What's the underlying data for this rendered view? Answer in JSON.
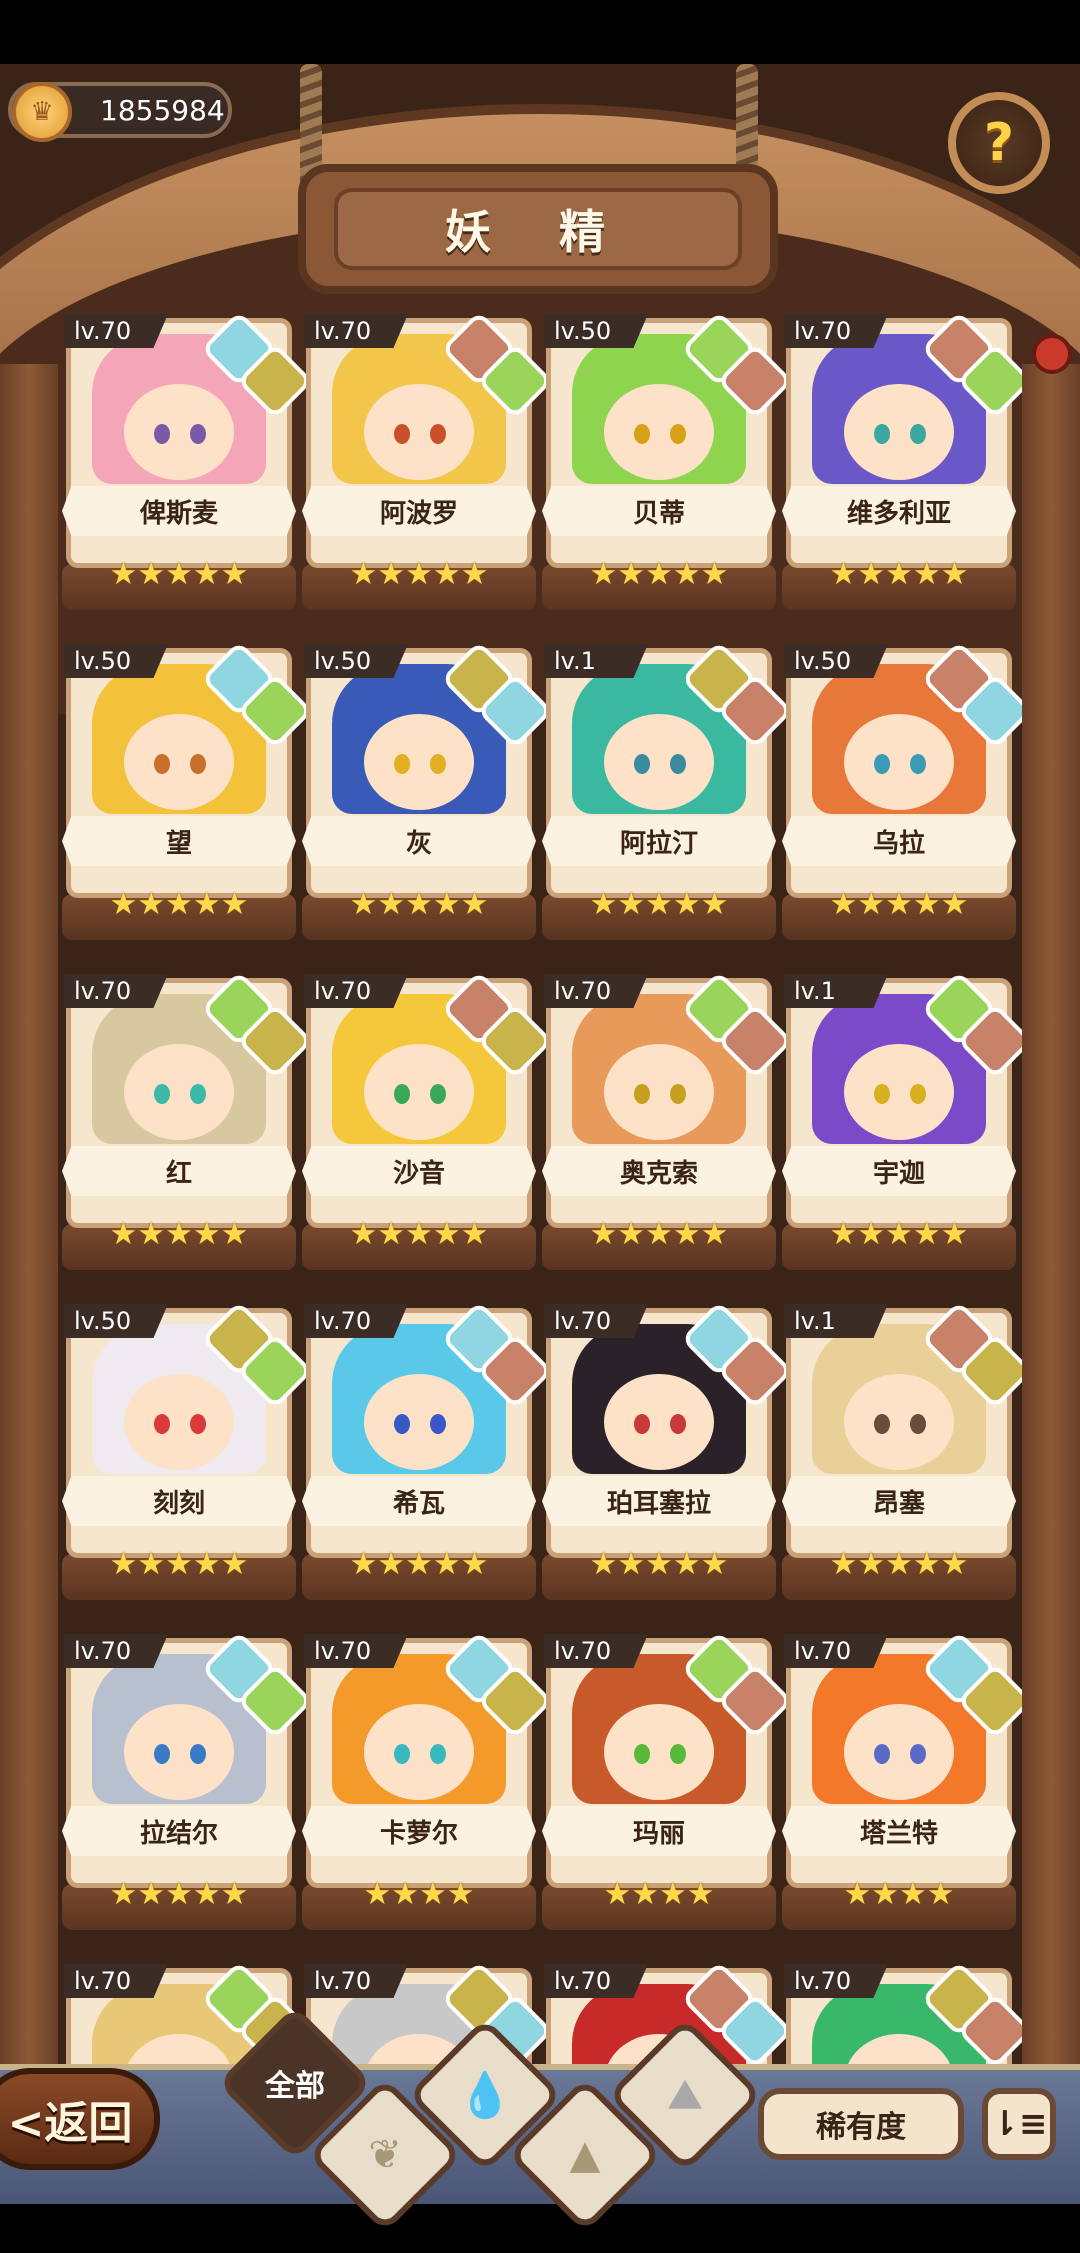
{
  "header": {
    "coins": "1855984",
    "title": "妖 精",
    "help_label": "?"
  },
  "fairies": [
    {
      "level": "lv.70",
      "name": "俾斯麦",
      "stars": "★★★★★",
      "elements": [
        "water",
        "earth"
      ],
      "hair": "#f4a6b8",
      "eye": "#7a5aa8"
    },
    {
      "level": "lv.70",
      "name": "阿波罗",
      "stars": "★★★★★",
      "elements": [
        "fire",
        "wood"
      ],
      "hair": "#f2c64a",
      "eye": "#c8502a"
    },
    {
      "level": "lv.50",
      "name": "贝蒂",
      "stars": "★★★★★",
      "elements": [
        "wood",
        "fire"
      ],
      "hair": "#8fd44e",
      "eye": "#d8a018"
    },
    {
      "level": "lv.70",
      "name": "维多利亚",
      "stars": "★★★★★",
      "elements": [
        "fire",
        "wood"
      ],
      "hair": "#6a58c8",
      "eye": "#3aa8a0"
    },
    {
      "level": "lv.50",
      "name": "望",
      "stars": "★★★★★",
      "elements": [
        "water",
        "wood"
      ],
      "hair": "#f4c23a",
      "eye": "#c8702a"
    },
    {
      "level": "lv.50",
      "name": "灰",
      "stars": "★★★★★",
      "elements": [
        "earth",
        "water"
      ],
      "hair": "#3a5ab8",
      "eye": "#e0b020"
    },
    {
      "level": "lv.1",
      "name": "阿拉汀",
      "stars": "★★★★★",
      "elements": [
        "earth",
        "fire"
      ],
      "hair": "#3ab8a0",
      "eye": "#3a8aa0"
    },
    {
      "level": "lv.50",
      "name": "乌拉",
      "stars": "★★★★★",
      "elements": [
        "fire",
        "water"
      ],
      "hair": "#e8783a",
      "eye": "#3a9ab8"
    },
    {
      "level": "lv.70",
      "name": "红",
      "stars": "★★★★★",
      "elements": [
        "wood",
        "earth"
      ],
      "hair": "#d8c8a0",
      "eye": "#3ab8a8"
    },
    {
      "level": "lv.70",
      "name": "沙音",
      "stars": "★★★★★",
      "elements": [
        "fire",
        "earth"
      ],
      "hair": "#f4c83a",
      "eye": "#3aa858"
    },
    {
      "level": "lv.70",
      "name": "奥克索",
      "stars": "★★★★★",
      "elements": [
        "wood",
        "fire"
      ],
      "hair": "#e89a5a",
      "eye": "#c8a020"
    },
    {
      "level": "lv.1",
      "name": "宇迦",
      "stars": "★★★★★",
      "elements": [
        "wood",
        "fire"
      ],
      "hair": "#7a4ac8",
      "eye": "#d8b020"
    },
    {
      "level": "lv.50",
      "name": "刻刻",
      "stars": "★★★★★",
      "elements": [
        "earth",
        "wood"
      ],
      "hair": "#eeeaf0",
      "eye": "#d83a3a"
    },
    {
      "level": "lv.70",
      "name": "希瓦",
      "stars": "★★★★★",
      "elements": [
        "water",
        "fire"
      ],
      "hair": "#5ac8e8",
      "eye": "#3a58c8"
    },
    {
      "level": "lv.70",
      "name": "珀耳塞拉",
      "stars": "★★★★★",
      "elements": [
        "water",
        "fire"
      ],
      "hair": "#2a2228",
      "eye": "#c83a3a"
    },
    {
      "level": "lv.1",
      "name": "昂塞",
      "stars": "★★★★★",
      "elements": [
        "fire",
        "earth"
      ],
      "hair": "#e8d098",
      "eye": "#6a4a3a"
    },
    {
      "level": "lv.70",
      "name": "拉结尔",
      "stars": "★★★★★",
      "elements": [
        "water",
        "wood"
      ],
      "hair": "#b8c0d0",
      "eye": "#3a78c8"
    },
    {
      "level": "lv.70",
      "name": "卡萝尔",
      "stars": "★★★★",
      "elements": [
        "water",
        "earth"
      ],
      "hair": "#f49a2a",
      "eye": "#3ab8c0"
    },
    {
      "level": "lv.70",
      "name": "玛丽",
      "stars": "★★★★",
      "elements": [
        "wood",
        "fire"
      ],
      "hair": "#c85a2a",
      "eye": "#58b83a"
    },
    {
      "level": "lv.70",
      "name": "塔兰特",
      "stars": "★★★★",
      "elements": [
        "water",
        "earth"
      ],
      "hair": "#f4782a",
      "eye": "#5a6ac8"
    },
    {
      "level": "lv.70",
      "name": "",
      "stars": "",
      "elements": [
        "wood",
        "earth"
      ],
      "hair": "#e8c878",
      "eye": "#3a8ab8"
    },
    {
      "level": "lv.70",
      "name": "",
      "stars": "",
      "elements": [
        "earth",
        "water"
      ],
      "hair": "#c8c8c8",
      "eye": "#3a3a3a"
    },
    {
      "level": "lv.70",
      "name": "",
      "stars": "",
      "elements": [
        "fire",
        "water"
      ],
      "hair": "#c82a2a",
      "eye": "#3a3a3a"
    },
    {
      "level": "lv.70",
      "name": "",
      "stars": "",
      "elements": [
        "earth",
        "fire"
      ],
      "hair": "#3ab86a",
      "eye": "#3a3a3a"
    }
  ],
  "element_colors": {
    "water": "#8fd6e0",
    "wood": "#9ad45a",
    "earth": "#c8b44a",
    "fire": "#c8826a"
  },
  "bottom": {
    "back_label": "<返回",
    "filter_all": "全部",
    "rarity_label": "稀有度",
    "sort_icon": "⇂≡"
  }
}
